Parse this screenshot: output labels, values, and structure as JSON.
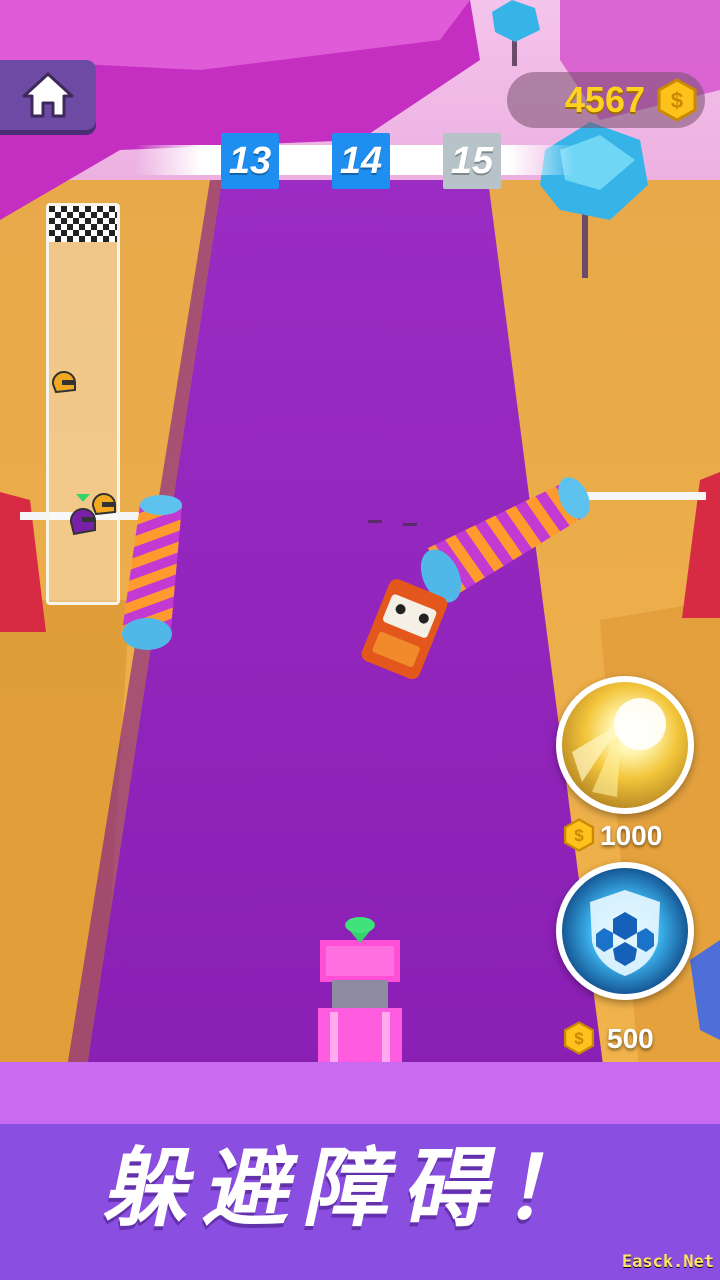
{
  "hud": {
    "coins": "4567",
    "coin_symbol": "$",
    "levels": {
      "previous": "13",
      "current": "14",
      "next": "15"
    }
  },
  "powerups": [
    {
      "name": "boost",
      "price": "1000"
    },
    {
      "name": "shield",
      "price": "500"
    }
  ],
  "banner": {
    "text": "躲避障碍！"
  },
  "watermark": "Easck.Net",
  "icons": {
    "home": "home-icon",
    "coin": "coin-icon",
    "finish": "checkered-flag-icon",
    "opponent": "helmet-icon",
    "player": "player-helmet-icon"
  },
  "colors": {
    "road": "#8a1fb4",
    "sand": "#efae45",
    "cliff": "#c42fc1",
    "banner": "#8a4ee0",
    "coin": "#ffd21f",
    "level_active": "#1e8ff0",
    "level_next": "#b8c3c9"
  }
}
